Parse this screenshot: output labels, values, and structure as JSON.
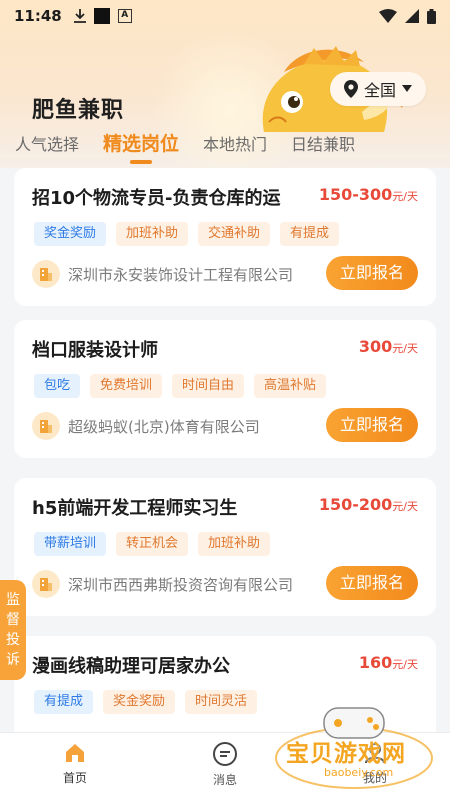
{
  "status_bar": {
    "time": "11:48"
  },
  "header": {
    "app_title": "肥鱼兼职",
    "location_label": "全国"
  },
  "tabs": [
    {
      "label": "人气选择",
      "active": false
    },
    {
      "label": "精选岗位",
      "active": true
    },
    {
      "label": "本地热门",
      "active": false
    },
    {
      "label": "日结兼职",
      "active": false
    }
  ],
  "jobs": [
    {
      "title": "招10个物流专员-负责仓库的运",
      "salary": "150-300",
      "unit": "元/天",
      "tags": [
        {
          "text": "奖金奖励",
          "color": "blue"
        },
        {
          "text": "加班补助",
          "color": "orange"
        },
        {
          "text": "交通补助",
          "color": "orange"
        },
        {
          "text": "有提成",
          "color": "orange"
        }
      ],
      "company": "深圳市永安装饰设计工程有限公司",
      "apply_label": "立即报名"
    },
    {
      "title": "档口服装设计师",
      "salary": "300",
      "unit": "元/天",
      "tags": [
        {
          "text": "包吃",
          "color": "blue"
        },
        {
          "text": "免费培训",
          "color": "orange"
        },
        {
          "text": "时间自由",
          "color": "orange"
        },
        {
          "text": "高温补贴",
          "color": "orange"
        }
      ],
      "company": "超级蚂蚁(北京)体育有限公司",
      "apply_label": "立即报名"
    },
    {
      "title": "h5前端开发工程师实习生",
      "salary": "150-200",
      "unit": "元/天",
      "tags": [
        {
          "text": "带薪培训",
          "color": "blue"
        },
        {
          "text": "转正机会",
          "color": "orange"
        },
        {
          "text": "加班补助",
          "color": "orange"
        }
      ],
      "company": "深圳市西西弗斯投资咨询有限公司",
      "apply_label": "立即报名"
    },
    {
      "title": "漫画线稿助理可居家办公",
      "salary": "160",
      "unit": "元/天",
      "tags": [
        {
          "text": "有提成",
          "color": "blue"
        },
        {
          "text": "奖金奖励",
          "color": "orange"
        },
        {
          "text": "时间灵活",
          "color": "orange"
        }
      ],
      "company": "",
      "apply_label": ""
    }
  ],
  "side_tab": {
    "label": [
      "监",
      "督",
      "投",
      "诉"
    ]
  },
  "bottom_nav": [
    {
      "label": "首页",
      "icon": "home-icon",
      "active": true
    },
    {
      "label": "消息",
      "icon": "message-icon",
      "active": false
    },
    {
      "label": "我的",
      "icon": "user-icon",
      "active": false
    }
  ],
  "watermark": {
    "text": "宝贝游戏网",
    "url": "baobeiy.com"
  },
  "colors": {
    "accent": "#f08a1d",
    "salary": "#e84a3a",
    "tag_blue": "#2d7be5",
    "tag_orange": "#e0782e"
  }
}
